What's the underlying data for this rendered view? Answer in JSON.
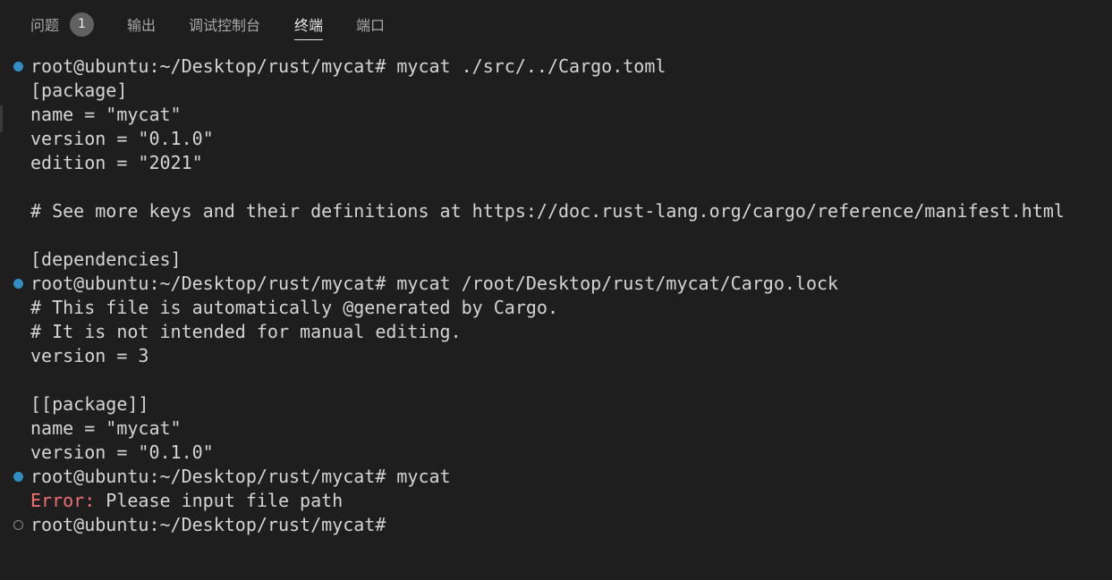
{
  "tabs": [
    {
      "label": "问题",
      "badge": "1"
    },
    {
      "label": "输出"
    },
    {
      "label": "调试控制台"
    },
    {
      "label": "终端",
      "active": true
    },
    {
      "label": "端口"
    }
  ],
  "terminal": {
    "lines": [
      {
        "text": "root@ubuntu:~/Desktop/rust/mycat# mycat ./src/../Cargo.toml",
        "decoration": "success"
      },
      {
        "text": "[package]"
      },
      {
        "text": "name = \"mycat\""
      },
      {
        "text": "version = \"0.1.0\""
      },
      {
        "text": "edition = \"2021\""
      },
      {
        "text": ""
      },
      {
        "text": "# See more keys and their definitions at https://doc.rust-lang.org/cargo/reference/manifest.html"
      },
      {
        "text": ""
      },
      {
        "text": "[dependencies]"
      },
      {
        "text": "root@ubuntu:~/Desktop/rust/mycat# mycat /root/Desktop/rust/mycat/Cargo.lock",
        "decoration": "success"
      },
      {
        "text": "# This file is automatically @generated by Cargo."
      },
      {
        "text": "# It is not intended for manual editing."
      },
      {
        "text": "version = 3"
      },
      {
        "text": ""
      },
      {
        "text": "[[package]]"
      },
      {
        "text": "name = \"mycat\""
      },
      {
        "text": "version = \"0.1.0\""
      },
      {
        "text": "root@ubuntu:~/Desktop/rust/mycat# mycat",
        "decoration": "success"
      },
      {
        "error_label": "Error:",
        "text": " Please input file path"
      },
      {
        "text": "root@ubuntu:~/Desktop/rust/mycat#",
        "decoration": "pending"
      }
    ]
  },
  "colors": {
    "background": "#1e1e1e",
    "text": "#d4d4d4",
    "error": "#f07070",
    "decoration_success": "#2f8fc4",
    "decoration_pending": "#8a8a8a"
  }
}
